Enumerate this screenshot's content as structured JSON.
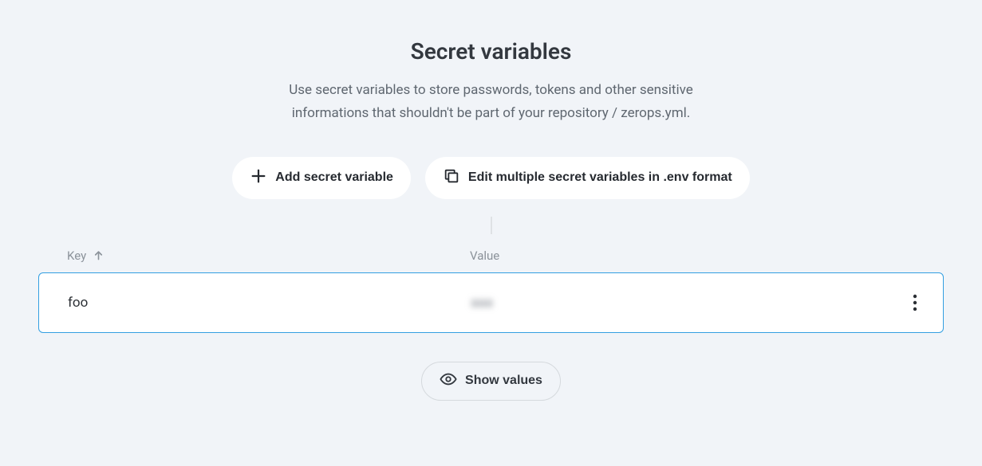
{
  "header": {
    "title": "Secret variables",
    "description": "Use secret variables to store passwords, tokens and other sensitive informations that shouldn't be part of your repository / zerops.yml."
  },
  "actions": {
    "add_label": "Add secret variable",
    "edit_multiple_label": "Edit multiple secret variables in .env format"
  },
  "table": {
    "columns": {
      "key": "Key",
      "value": "Value"
    },
    "rows": [
      {
        "key": "foo",
        "value_masked": "aaa"
      }
    ]
  },
  "footer": {
    "show_values_label": "Show values"
  }
}
